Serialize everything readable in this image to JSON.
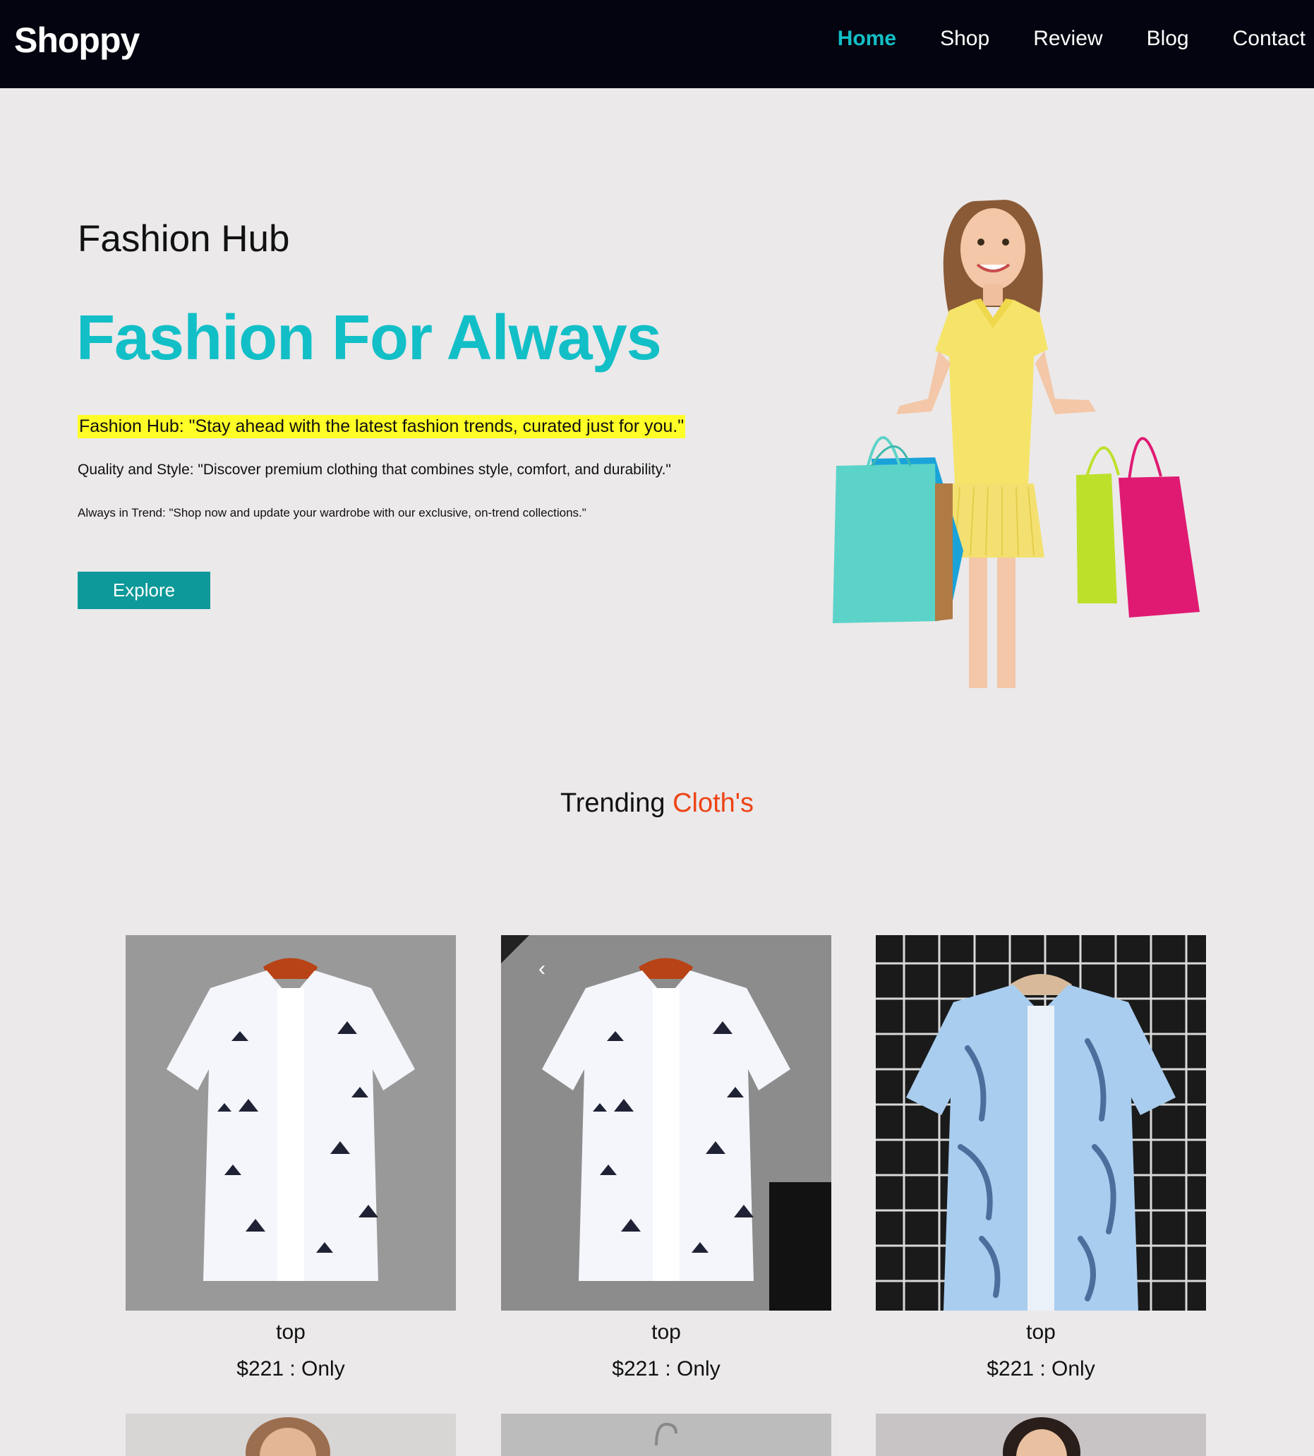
{
  "header": {
    "logo": "Shoppy",
    "nav": [
      {
        "label": "Home",
        "active": true
      },
      {
        "label": "Shop",
        "active": false
      },
      {
        "label": "Review",
        "active": false
      },
      {
        "label": "Blog",
        "active": false
      },
      {
        "label": "Contact",
        "active": false
      }
    ]
  },
  "hero": {
    "subtitle": "Fashion Hub",
    "title": "Fashion For Always",
    "tagline_1": "Fashion Hub: \"Stay ahead with the latest fashion trends, curated just for you.\"",
    "tagline_2": "Quality and Style: \"Discover premium clothing that combines style, comfort, and durability.\"",
    "tagline_3": "Always in Trend: \"Shop now and update your wardrobe with our exclusive, on-trend collections.\"",
    "cta_label": "Explore"
  },
  "trending": {
    "label_plain": "Trending",
    "label_accent": "Cloth's"
  },
  "products": [
    {
      "name": "top",
      "price": "$221 : Only",
      "image_icon": "white-palm-shirt-icon"
    },
    {
      "name": "top",
      "price": "$221 : Only",
      "image_icon": "white-palm-shirt-icon"
    },
    {
      "name": "top",
      "price": "$221 : Only",
      "image_icon": "blue-leaf-shirt-icon"
    }
  ],
  "colors": {
    "nav_bg": "#03040f",
    "accent_teal": "#12bfc7",
    "button_teal": "#0d9999",
    "highlight_yellow": "#fffe26",
    "accent_orange": "#ee4314",
    "page_bg": "#ebe9ea"
  }
}
